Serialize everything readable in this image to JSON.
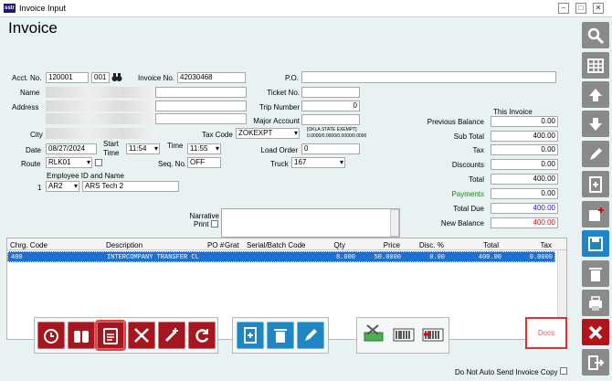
{
  "window": {
    "title": "Invoice Input",
    "logo": "sstr"
  },
  "page": {
    "title": "Invoice"
  },
  "header": {
    "acct_label": "Acct. No.",
    "acct_no": "120001",
    "acct_suffix": "001",
    "invoice_label": "Invoice No.",
    "invoice_no": "42030468",
    "po_label": "P.O.",
    "po": "",
    "name_label": "Name",
    "address_label": "Address",
    "city_label": "City",
    "ticket_label": "Ticket No.",
    "ticket": "",
    "trip_label": "Trip Number",
    "trip": "0",
    "major_label": "Major Account",
    "major": "",
    "taxcode_label": "Tax Code",
    "taxcode": "ZOKEXPT",
    "tax_note_1": "[OKLA STATE EXEMPT]",
    "tax_note_2": "0.0000/0.0000/0.0000/0.0000",
    "date_label": "Date",
    "date": "08/27/2024",
    "start_time_label_1": "Start",
    "start_time_label_2": "Time",
    "start_time": "11:54",
    "time_label": "Time",
    "time": "11:55",
    "load_order_label": "Load Order",
    "load_order": "0",
    "route_label": "Route",
    "route": "RLK01",
    "seq_label": "Seq. No.",
    "seq": "OFF",
    "truck_label": "Truck",
    "truck": "167",
    "employee_label": "Employee ID and Name",
    "employee_idx": "1",
    "employee_id": "AR2",
    "employee_name": "ARS Tech 2",
    "narrative_label_1": "Narrative",
    "narrative_label_2": "Print"
  },
  "totals": {
    "section_label": "This Invoice",
    "rows": [
      {
        "label": "Previous Balance",
        "value": "0.00"
      },
      {
        "label": "Sub Total",
        "value": "400.00"
      },
      {
        "label": "Tax",
        "value": "0.00"
      },
      {
        "label": "Discounts",
        "value": "0.00"
      },
      {
        "label": "Total",
        "value": "400.00"
      },
      {
        "label": "Payments",
        "value": "0.00"
      },
      {
        "label": "Total Due",
        "value": "400.00"
      },
      {
        "label": "New Balance",
        "value": "400.00"
      }
    ],
    "colors": {
      "payments": "#1a8a1a",
      "total_due": "#1a1ac8",
      "new_balance": "#d01010"
    }
  },
  "grid": {
    "columns": [
      "Chrg. Code",
      "Description",
      "PO #",
      "Grat",
      "Serial/Batch Code",
      "Qty",
      "Price",
      "Disc. %",
      "Total",
      "Tax"
    ],
    "rows": [
      [
        "400",
        "INTERCOMPANY TRANSFER CL",
        "",
        "",
        "",
        "8.000",
        "50.0000",
        "0.00",
        "400.00",
        "0.0000"
      ]
    ]
  },
  "toolbar": {
    "docs_label": "Docs",
    "no_auto_send_label": "Do Not Auto Send Invoice Copy"
  },
  "icons": {
    "sidebar": [
      "search-icon",
      "grid-icon",
      "arrow-up-icon",
      "arrow-down-icon",
      "edit-icon",
      "new-document-icon",
      "add-note-icon",
      "save-icon",
      "delete-icon",
      "print-icon",
      "close-icon",
      "exit-icon"
    ]
  }
}
